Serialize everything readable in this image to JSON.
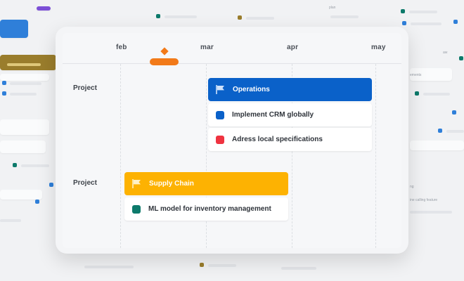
{
  "timeline": {
    "months": [
      "feb",
      "mar",
      "apr",
      "may"
    ],
    "today_marker_color": "#f27a19"
  },
  "projects": [
    {
      "label": "Project",
      "name": "Operations",
      "color": "#0a61c9",
      "tasks": [
        {
          "name": "Implement CRM globally",
          "color": "#0a61c9"
        },
        {
          "name": "Adress local specifications",
          "color": "#ef3340"
        }
      ]
    },
    {
      "label": "Project",
      "name": "Supply Chain",
      "color": "#fdb202",
      "tasks": [
        {
          "name": "ML model for inventory management",
          "color": "#0d7a6b"
        }
      ]
    }
  ],
  "icons": {
    "project_flag": "flag-icon",
    "task_square": "task-color-square"
  }
}
